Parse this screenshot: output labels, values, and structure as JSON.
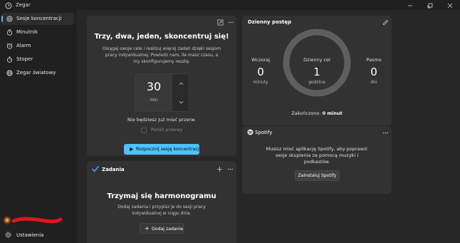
{
  "window": {
    "title": "Zegar",
    "controls": [
      "minimize",
      "maximize",
      "close"
    ]
  },
  "sidebar": {
    "items": [
      {
        "label": "Sesje koncentracji",
        "icon": "focus-sessions-icon",
        "active": true
      },
      {
        "label": "Minutnik",
        "icon": "timer-icon",
        "active": false
      },
      {
        "label": "Alarm",
        "icon": "alarm-icon",
        "active": false
      },
      {
        "label": "Stoper",
        "icon": "stopwatch-icon",
        "active": false
      },
      {
        "label": "Zegar światowy",
        "icon": "globe-icon",
        "active": false
      }
    ],
    "settings_label": "Ustawienia"
  },
  "focus": {
    "title": "Trzy, dwa, jeden, skoncentruj się!",
    "description": "Osiągaj swoje cele i realizuj więcej zadań dzięki sesjom pracy indywidualnej. Powiedz nam, ile masz czasu, a my skonfigurujemy resztę.",
    "timer_value": "30",
    "timer_unit": "min",
    "break_text": "Nie będziesz już mieć przerw.",
    "skip_breaks_label": "Pomiń przerwy",
    "start_button_label": "Rozpocznij sesję koncentracji"
  },
  "daily": {
    "title": "Dzienny postęp",
    "yesterday": {
      "label": "Wczoraj",
      "value": "0",
      "unit": "minuty"
    },
    "goal": {
      "label": "Dzienny cel",
      "value": "1",
      "unit": "godzina"
    },
    "streak": {
      "label": "Pasmo",
      "value": "0",
      "unit": "dni"
    },
    "completed_label": "Zakończono:",
    "completed_value": "0 minut",
    "progress_fraction": 0
  },
  "spotify": {
    "title": "Spotify",
    "message": "Musisz mieć aplikację Spotify, aby poprawić sesje skupienia za pomocą muzyki i podkastów.",
    "install_label": "Zainstaluj Spotify"
  },
  "tasks": {
    "title": "Zadania",
    "heading": "Trzymaj się harmonogramu",
    "description": "Dodaj zadania i przypisz je do sesji pracy indywidualnej w ciągu dnia.",
    "add_label": "Dodaj zadanie",
    "add_symbol": "+"
  },
  "colors": {
    "accent": "#4cc2ff",
    "background": "#202020",
    "card": "#323232",
    "redacted": "#e0141e"
  }
}
